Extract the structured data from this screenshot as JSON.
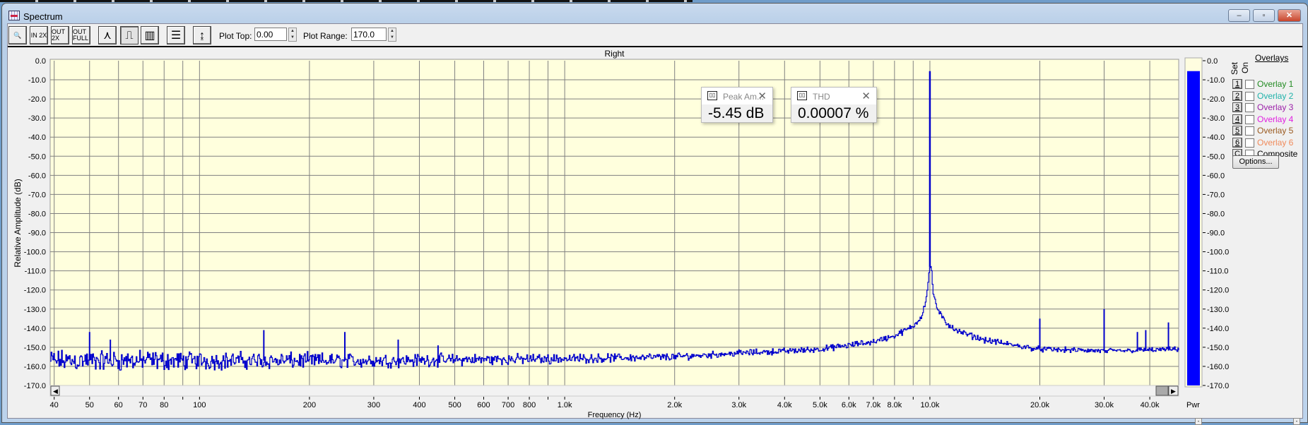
{
  "window": {
    "title": "Spectrum",
    "minimize": "‒",
    "maximize": "▫",
    "close": "✕"
  },
  "toolbar": {
    "buttons": [
      {
        "name": "zoom",
        "label": "🔍"
      },
      {
        "name": "zoom-in-2x",
        "label": "IN 2X"
      },
      {
        "name": "zoom-out-2x",
        "label": "OUT 2X"
      },
      {
        "name": "zoom-out-full",
        "label": "OUT FULL"
      },
      {
        "name": "line-mode",
        "label": "⋏"
      },
      {
        "name": "step-mode",
        "label": "⎍"
      },
      {
        "name": "bar-mode",
        "label": "▥"
      },
      {
        "name": "settings",
        "label": "☰"
      },
      {
        "name": "autoscale",
        "label": "↨"
      }
    ],
    "plot_top_label": "Plot Top:",
    "plot_top_value": "0.00",
    "plot_range_label": "Plot Range:",
    "plot_range_value": "170.0"
  },
  "meters": [
    {
      "title": "Peak Am...",
      "value": "-5.45 dB"
    },
    {
      "title": "THD",
      "value": "0.00007 %"
    }
  ],
  "overlays": {
    "header": "Overlays",
    "set_label": "Set",
    "on_label": "On",
    "items": [
      {
        "key": "1",
        "label": "Overlay 1",
        "color": "#228b22",
        "on": false
      },
      {
        "key": "2",
        "label": "Overlay 2",
        "color": "#20b2aa",
        "on": false
      },
      {
        "key": "3",
        "label": "Overlay 3",
        "color": "#9b1fa8",
        "on": false
      },
      {
        "key": "4",
        "label": "Overlay 4",
        "color": "#e020e0",
        "on": false
      },
      {
        "key": "5",
        "label": "Overlay 5",
        "color": "#9a5a20",
        "on": false
      },
      {
        "key": "6",
        "label": "Overlay 6",
        "color": "#f08a5a",
        "on": false
      },
      {
        "key": "C",
        "label": "Composite",
        "color": "#000000",
        "on": false
      }
    ],
    "options_label": "Options..."
  },
  "level_meter": {
    "label": "Pwr",
    "value_db": -5.45,
    "color": "#0000ff",
    "ticks": [
      "0.0",
      "-10.0",
      "-20.0",
      "-30.0",
      "-40.0",
      "-50.0",
      "-60.0",
      "-70.0",
      "-80.0",
      "-90.0",
      "-100.0",
      "-110.0",
      "-120.0",
      "-130.0",
      "-140.0",
      "-150.0",
      "-160.0",
      "-170.0"
    ]
  },
  "chart_data": {
    "type": "line",
    "title": "Right",
    "xlabel": "Frequency (Hz)",
    "ylabel": "Relative Amplitude (dB)",
    "xscale": "log",
    "xlim": [
      39,
      48000
    ],
    "ylim": [
      -170,
      0
    ],
    "grid": true,
    "line_color": "#0000cc",
    "background": "#ffffdd",
    "ytick_labels": [
      "0.0",
      "-10.0",
      "-20.0",
      "-30.0",
      "-40.0",
      "-50.0",
      "-60.0",
      "-70.0",
      "-80.0",
      "-90.0",
      "-100.0",
      "-110.0",
      "-120.0",
      "-130.0",
      "-140.0",
      "-150.0",
      "-160.0",
      "-170.0"
    ],
    "xticks": [
      {
        "f": 40,
        "label": "40"
      },
      {
        "f": 50,
        "label": "50"
      },
      {
        "f": 60,
        "label": "60"
      },
      {
        "f": 70,
        "label": "70"
      },
      {
        "f": 80,
        "label": "80"
      },
      {
        "f": 90,
        "label": ""
      },
      {
        "f": 100,
        "label": "100"
      },
      {
        "f": 200,
        "label": "200"
      },
      {
        "f": 300,
        "label": "300"
      },
      {
        "f": 400,
        "label": "400"
      },
      {
        "f": 500,
        "label": "500"
      },
      {
        "f": 600,
        "label": "600"
      },
      {
        "f": 700,
        "label": "700"
      },
      {
        "f": 800,
        "label": "800"
      },
      {
        "f": 900,
        "label": ""
      },
      {
        "f": 1000,
        "label": "1.0k"
      },
      {
        "f": 2000,
        "label": "2.0k"
      },
      {
        "f": 3000,
        "label": "3.0k"
      },
      {
        "f": 4000,
        "label": "4.0k"
      },
      {
        "f": 5000,
        "label": "5.0k"
      },
      {
        "f": 6000,
        "label": "6.0k"
      },
      {
        "f": 7000,
        "label": "7.0k"
      },
      {
        "f": 8000,
        "label": "8.0k"
      },
      {
        "f": 9000,
        "label": ""
      },
      {
        "f": 10000,
        "label": "10.0k"
      },
      {
        "f": 20000,
        "label": "20.0k"
      },
      {
        "f": 30000,
        "label": "30.0k"
      },
      {
        "f": 40000,
        "label": "40.0k"
      }
    ],
    "noise_floor": [
      [
        39,
        -157
      ],
      [
        100,
        -157
      ],
      [
        300,
        -157
      ],
      [
        1000,
        -156
      ],
      [
        2000,
        -155
      ],
      [
        3000,
        -153
      ],
      [
        4000,
        -152
      ],
      [
        5000,
        -151
      ],
      [
        6000,
        -149
      ],
      [
        7000,
        -147
      ],
      [
        8000,
        -144
      ],
      [
        9000,
        -139
      ],
      [
        9500,
        -133
      ],
      [
        9800,
        -122
      ],
      [
        9950,
        -108
      ],
      [
        10050,
        -108
      ],
      [
        10200,
        -122
      ],
      [
        10500,
        -131
      ],
      [
        11000,
        -137
      ],
      [
        12000,
        -142
      ],
      [
        14000,
        -146
      ],
      [
        17000,
        -149
      ],
      [
        20000,
        -151
      ],
      [
        30000,
        -152
      ],
      [
        48000,
        -151
      ]
    ],
    "noise_spread_db": [
      [
        39,
        7
      ],
      [
        200,
        5
      ],
      [
        1000,
        3
      ],
      [
        3000,
        2
      ],
      [
        10000,
        2
      ],
      [
        48000,
        1.5
      ]
    ],
    "peaks": [
      [
        50,
        -142
      ],
      [
        57,
        -146
      ],
      [
        150,
        -141
      ],
      [
        250,
        -142
      ],
      [
        350,
        -146
      ],
      [
        450,
        -149
      ],
      [
        10000,
        -5.45
      ],
      [
        20000,
        -135
      ],
      [
        30000,
        -130
      ],
      [
        37000,
        -142
      ],
      [
        39000,
        -141
      ],
      [
        45000,
        -137
      ]
    ]
  }
}
